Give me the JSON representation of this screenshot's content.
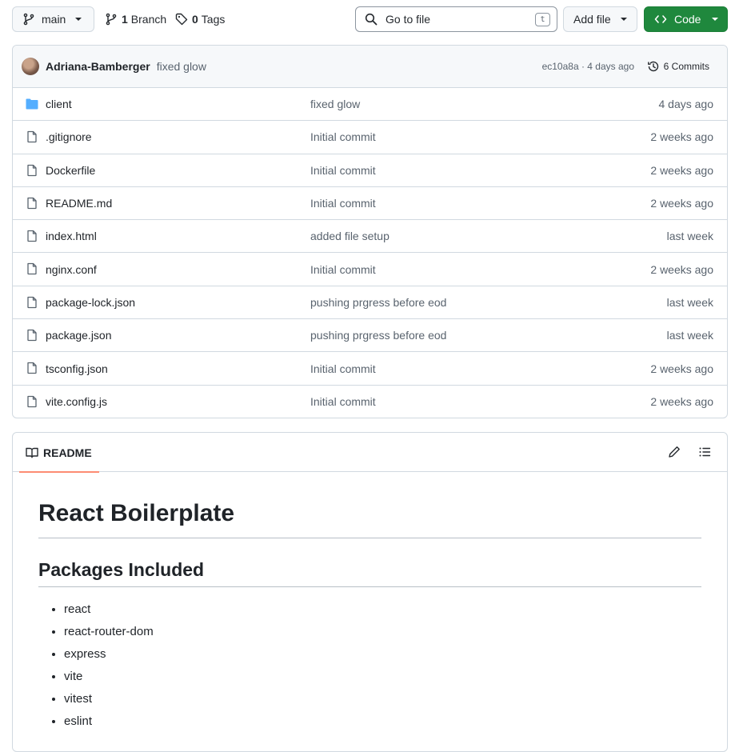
{
  "toolbar": {
    "branch_label": "main",
    "branches_count": "1",
    "branches_label": "Branch",
    "tags_count": "0",
    "tags_label": "Tags",
    "search_placeholder": "Go to file",
    "search_shortcut": "t",
    "add_file_label": "Add file",
    "code_label": "Code",
    "code_color": "#1f883d"
  },
  "commit": {
    "author": "Adriana-Bamberger",
    "message": "fixed glow",
    "meta": "ec10a8a · 4 days ago",
    "commits_label": "6 Commits"
  },
  "files": [
    {
      "name": "client",
      "type": "folder",
      "message": "fixed glow",
      "age": "4 days ago"
    },
    {
      "name": ".gitignore",
      "type": "file",
      "message": "Initial commit",
      "age": "2 weeks ago"
    },
    {
      "name": "Dockerfile",
      "type": "file",
      "message": "Initial commit",
      "age": "2 weeks ago"
    },
    {
      "name": "README.md",
      "type": "file",
      "message": "Initial commit",
      "age": "2 weeks ago"
    },
    {
      "name": "index.html",
      "type": "file",
      "message": "added file setup",
      "age": "last week"
    },
    {
      "name": "nginx.conf",
      "type": "file",
      "message": "Initial commit",
      "age": "2 weeks ago"
    },
    {
      "name": "package-lock.json",
      "type": "file",
      "message": "pushing prgress before eod",
      "age": "last week"
    },
    {
      "name": "package.json",
      "type": "file",
      "message": "pushing prgress before eod",
      "age": "last week"
    },
    {
      "name": "tsconfig.json",
      "type": "file",
      "message": "Initial commit",
      "age": "2 weeks ago"
    },
    {
      "name": "vite.config.js",
      "type": "file",
      "message": "Initial commit",
      "age": "2 weeks ago"
    }
  ],
  "readme": {
    "tab_label": "README",
    "title": "React Boilerplate",
    "section_heading": "Packages Included",
    "packages": [
      "react",
      "react-router-dom",
      "express",
      "vite",
      "vitest",
      "eslint"
    ]
  }
}
